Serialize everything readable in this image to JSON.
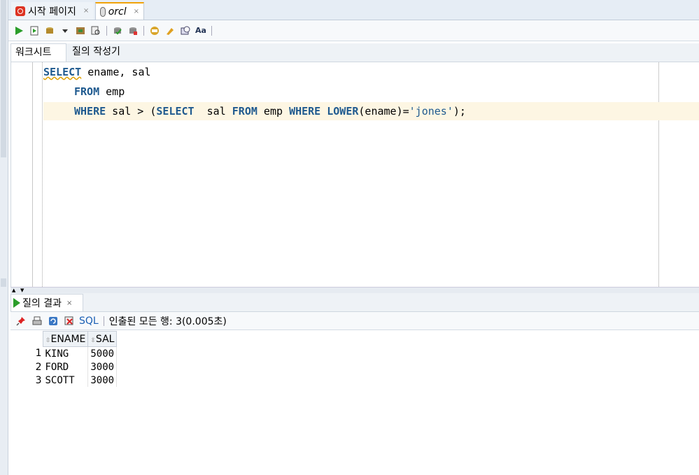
{
  "tabs": [
    {
      "label": "시작 페이지",
      "close": "×"
    },
    {
      "label": "orcl",
      "close": "×"
    }
  ],
  "toolbar": {
    "icons": [
      "run-statement-icon",
      "run-script-icon",
      "commit-icon",
      "dropdown-arrow-icon",
      "autotrace-icon",
      "explain-plan-icon",
      "commit-transaction-icon",
      "rollback-icon",
      "sql-tuning-icon",
      "clear-icon",
      "history-icon",
      "format-case-icon"
    ]
  },
  "subtabs": {
    "worksheet": "워크시트",
    "builder": "질의 작성기"
  },
  "editor": {
    "line1": {
      "kw1": "SELECT",
      "rest": " ename, sal"
    },
    "line2": {
      "kw1": "FROM",
      "rest": " emp"
    },
    "line3": {
      "kw1": "WHERE",
      "t1": " sal > (",
      "kw2": "SELECT",
      "t2": "  sal ",
      "kw3": "FROM",
      "t3": " emp ",
      "kw4": "WHERE",
      "t4": " ",
      "kw5": "LOWER",
      "t5": "(ename)=",
      "str": "'jones'",
      "t6": ");"
    }
  },
  "results": {
    "tab_label": "질의 결과",
    "tab_close": "×",
    "sql_label": "SQL",
    "status": "인출된 모든 행: 3(0.005초)",
    "columns": [
      "ENAME",
      "SAL"
    ],
    "rows": [
      {
        "n": "1",
        "ename": "KING",
        "sal": "5000"
      },
      {
        "n": "2",
        "ename": "FORD",
        "sal": "3000"
      },
      {
        "n": "3",
        "ename": "SCOTT",
        "sal": "3000"
      }
    ]
  }
}
